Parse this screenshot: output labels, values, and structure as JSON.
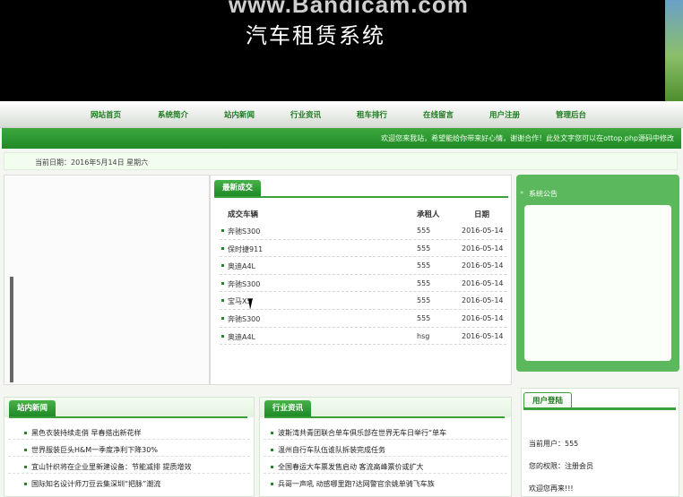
{
  "banner": {
    "watermark": "www.Bandicam.com",
    "title": "汽车租赁系统"
  },
  "nav": {
    "items": [
      "网站首页",
      "系统简介",
      "站内新闻",
      "行业资讯",
      "租车排行",
      "在线留言",
      "用户注册",
      "管理后台"
    ]
  },
  "notice_marquee": "欢迎您来我站，希望能给你带来好心情，谢谢合作！此处文字您可以在ottop.php源码中修改",
  "date_bar": {
    "text": "当前日期：2016年5月14日   星期六"
  },
  "deals": {
    "tab": "最新成交",
    "headers": {
      "car": "成交车辆",
      "renter": "承租人",
      "date": "日期"
    },
    "rows": [
      {
        "car": "奔驰S300",
        "renter": "555",
        "date": "2016-05-14"
      },
      {
        "car": "保时捷911",
        "renter": "555",
        "date": "2016-05-14"
      },
      {
        "car": "奥迪A4L",
        "renter": "555",
        "date": "2016-05-14"
      },
      {
        "car": "奔驰S300",
        "renter": "555",
        "date": "2016-05-14"
      },
      {
        "car": "宝马X5",
        "renter": "555",
        "date": "2016-05-14"
      },
      {
        "car": "奔驰S300",
        "renter": "555",
        "date": "2016-05-14"
      },
      {
        "car": "奥迪A4L",
        "renter": "hsg",
        "date": "2016-05-14"
      }
    ]
  },
  "system_notice": {
    "title": "系统公告"
  },
  "site_news": {
    "tab": "站内新闻",
    "items": [
      "黑色衣装持续走俏 早春搭出新花样",
      "世界服装巨头H&M一季度净利下降30%",
      "宜山针织将在企业里新建设备：节能减排 提质增效",
      "国际知名设计师刀豆云集深圳“把脉”潮流"
    ]
  },
  "industry_news": {
    "tab": "行业资讯",
    "items": [
      "波斯湾共青团联合单车俱乐部在世界无车日举行“单车",
      "温州自行车队伍谁队拆装完成任务",
      "全国春运大车票发售启动 客流高峰票价或扩大",
      "兵哥一声吼 动感哪里跑?达网警官余姚单骑飞车族"
    ]
  },
  "user_login": {
    "tab": "用户登陆",
    "current_user": "当前用户：555",
    "permission": "您的权限：注册会员",
    "welcome": "欢迎您再来!!!"
  }
}
